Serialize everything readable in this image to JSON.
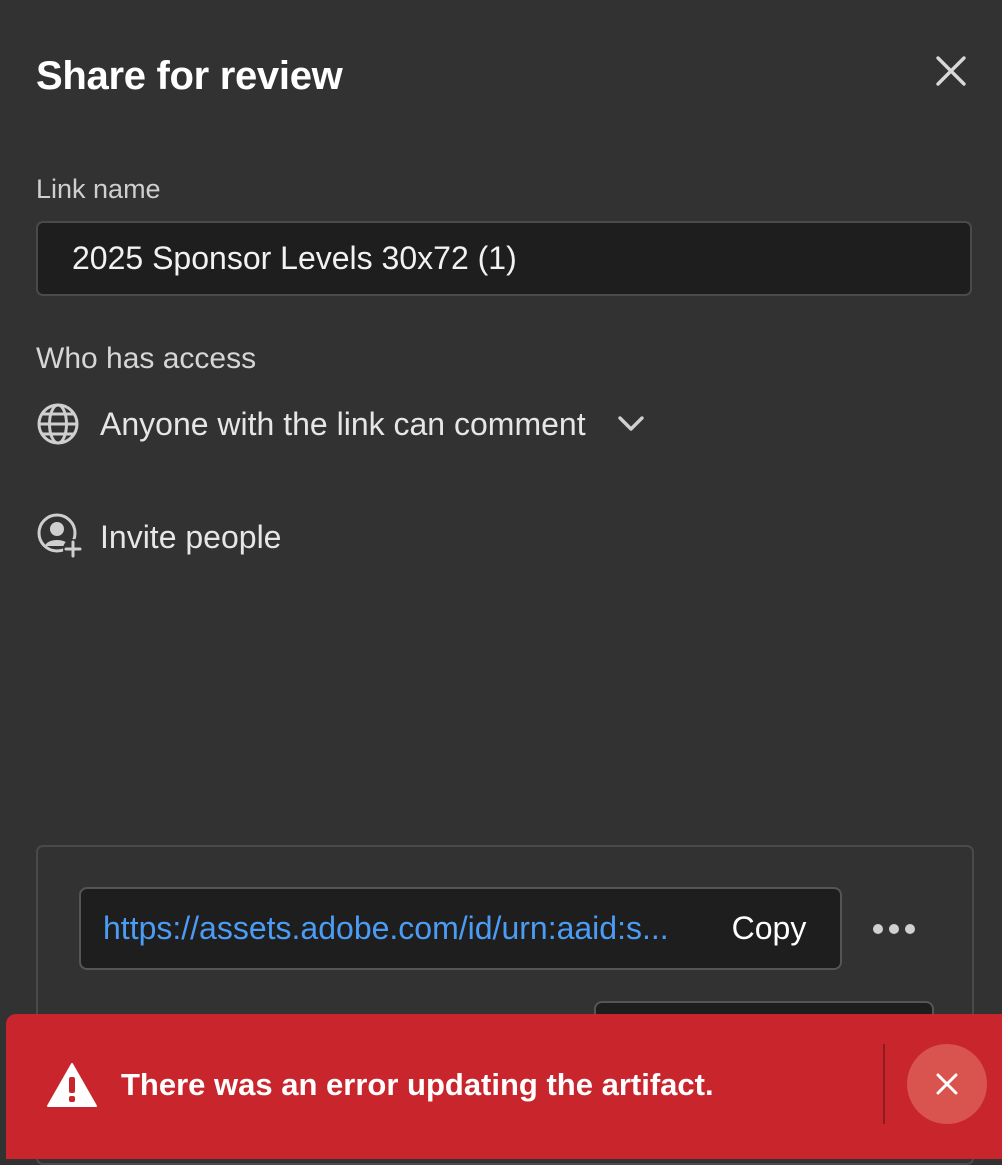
{
  "dialog": {
    "title": "Share for review",
    "close_icon": "close-icon"
  },
  "link_name": {
    "label": "Link name",
    "value": "2025 Sponsor Levels 30x72 (1)"
  },
  "access": {
    "label": "Who has access",
    "icon": "globe-icon",
    "selected": "Anyone with the link can comment",
    "dropdown_icon": "chevron-down-icon"
  },
  "invite": {
    "icon": "user-add-icon",
    "label": "Invite people"
  },
  "share_link": {
    "url": "https://assets.adobe.com/id/urn:aaid:s...",
    "copy_label": "Copy",
    "more_icon": "more-icon"
  },
  "toast": {
    "icon": "alert-icon",
    "message": "There was an error updating the artifact.",
    "close_icon": "close-icon",
    "color": "#c9252d"
  },
  "colors": {
    "background": "#323232",
    "input_background": "#1e1e1e",
    "link": "#4b9cf5",
    "error": "#c9252d"
  }
}
